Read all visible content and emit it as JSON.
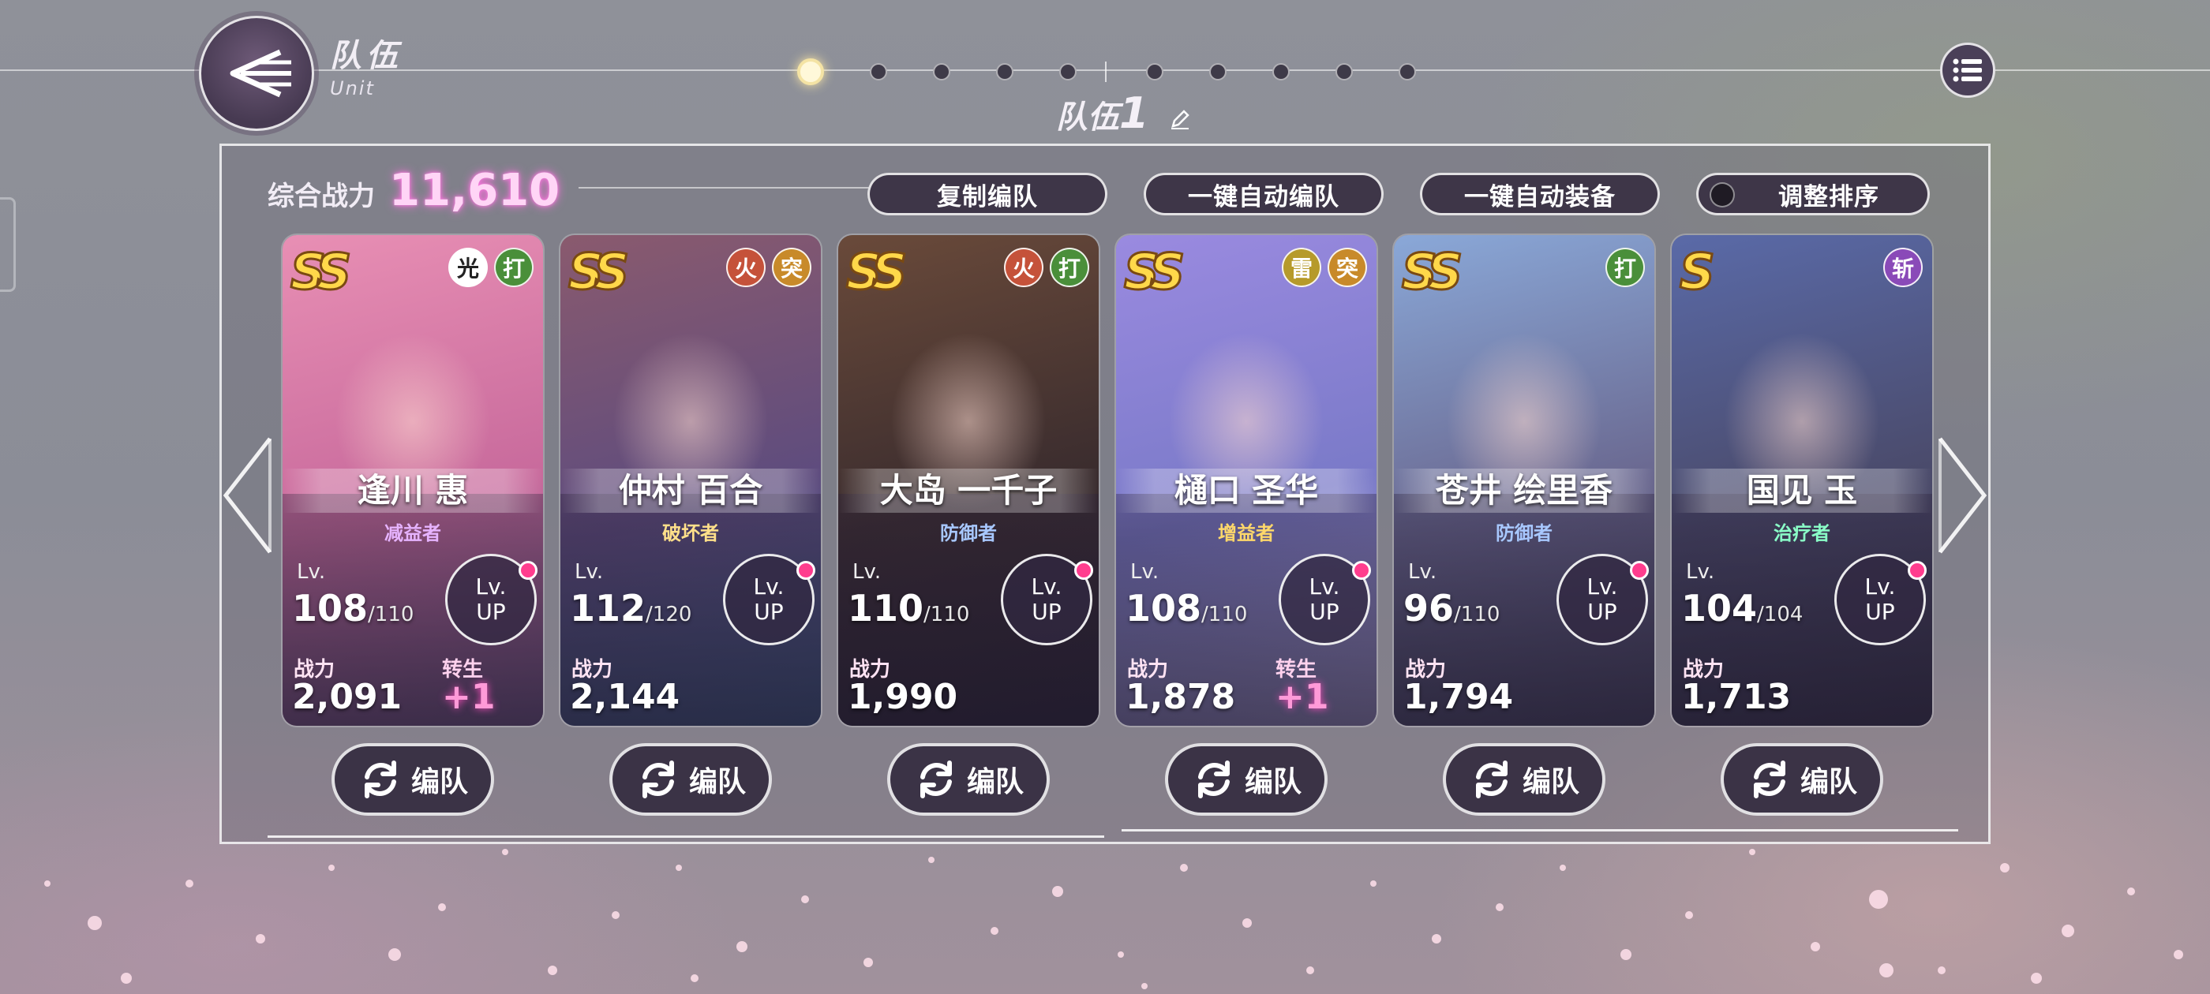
{
  "header": {
    "title_cn": "队伍",
    "title_en": "Unit",
    "team_prefix": "队伍",
    "team_number": "1",
    "pages": 10,
    "active_page": 1
  },
  "summary": {
    "power_label": "综合战力",
    "power_value": "11,610"
  },
  "buttons": {
    "copy": "复制编队",
    "auto_team": "一键自动编队",
    "auto_equip": "一键自动装备",
    "reorder": "调整排序"
  },
  "labels": {
    "lv": "Lv.",
    "lvup_top": "Lv.",
    "lvup_bottom": "UP",
    "power": "战力",
    "rebirth": "转生",
    "edit": "编队"
  },
  "colors": {
    "accent_pink": "#ff3d8e",
    "power_glow": "#ff6fe0",
    "rarity_gold": "#ffd84a"
  },
  "characters": [
    {
      "name": "逢川 惠",
      "role": "减益者",
      "role_color": "#e6b3ff",
      "rarity": "SS",
      "badges": [
        {
          "text": "光",
          "bg": "#ffffff",
          "fg": "#222222"
        },
        {
          "text": "打",
          "bg": "#4a8f3a",
          "fg": "#ffffff"
        }
      ],
      "lv": "108",
      "lv_max": "/110",
      "power": "2,091",
      "rebirth": "+1",
      "art": [
        "#e88fb4",
        "#c86a9c",
        "#7b5a8a"
      ]
    },
    {
      "name": "仲村 百合",
      "role": "破坏者",
      "role_color": "#ffe08a",
      "rarity": "SS",
      "badges": [
        {
          "text": "火",
          "bg": "#c5523a",
          "fg": "#ffffff"
        },
        {
          "text": "突",
          "bg": "#c88a2a",
          "fg": "#ffffff"
        }
      ],
      "lv": "112",
      "lv_max": "/120",
      "power": "2,144",
      "rebirth": "",
      "art": [
        "#8a5a6e",
        "#5e4c7e",
        "#3f5f8a"
      ]
    },
    {
      "name": "大岛 一千子",
      "role": "防御者",
      "role_color": "#a8c8ff",
      "rarity": "SS",
      "badges": [
        {
          "text": "火",
          "bg": "#c5523a",
          "fg": "#ffffff"
        },
        {
          "text": "打",
          "bg": "#4a8f3a",
          "fg": "#ffffff"
        }
      ],
      "lv": "110",
      "lv_max": "/110",
      "power": "1,990",
      "rebirth": "",
      "art": [
        "#6a4a3a",
        "#3a2c2e",
        "#2a2230"
      ]
    },
    {
      "name": "樋口 圣华",
      "role": "增益者",
      "role_color": "#ffd86a",
      "rarity": "SS",
      "badges": [
        {
          "text": "雷",
          "bg": "#b69a2a",
          "fg": "#ffffff"
        },
        {
          "text": "突",
          "bg": "#c88a2a",
          "fg": "#ffffff"
        }
      ],
      "lv": "108",
      "lv_max": "/110",
      "power": "1,878",
      "rebirth": "+1",
      "art": [
        "#9a8ae0",
        "#7a7ac8",
        "#b0a6d8"
      ]
    },
    {
      "name": "苍井 绘里香",
      "role": "防御者",
      "role_color": "#a8c8ff",
      "rarity": "SS",
      "badges": [
        {
          "text": "打",
          "bg": "#4a8f3a",
          "fg": "#ffffff"
        }
      ],
      "lv": "96",
      "lv_max": "/110",
      "power": "1,794",
      "rebirth": "",
      "art": [
        "#8aa8d8",
        "#6a6890",
        "#4a4660"
      ]
    },
    {
      "name": "国见 玉",
      "role": "治疗者",
      "role_color": "#8affc8",
      "rarity": "S",
      "badges": [
        {
          "text": "斩",
          "bg": "#8a4ab8",
          "fg": "#ffffff"
        }
      ],
      "lv": "104",
      "lv_max": "/104",
      "power": "1,713",
      "rebirth": "",
      "art": [
        "#5a6aa8",
        "#4a4a6a",
        "#3a3448"
      ]
    }
  ]
}
